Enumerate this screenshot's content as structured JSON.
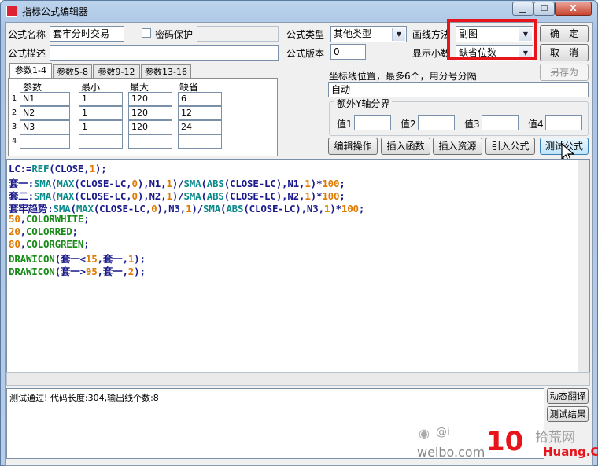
{
  "window": {
    "title": "指标公式编辑器",
    "min_label": "▁",
    "max_label": "☐",
    "close_label": "X"
  },
  "form": {
    "name_label": "公式名称",
    "name_value": "套牢分时交易",
    "password_label": "密码保护",
    "desc_label": "公式描述",
    "desc_value": "",
    "type_label": "公式类型",
    "type_value": "其他类型",
    "version_label": "公式版本",
    "version_value": "0",
    "draw_label": "画线方法",
    "draw_value": "副图",
    "decimal_label": "显示小数",
    "decimal_value": "缺省位数"
  },
  "buttons": {
    "ok": "确　定",
    "cancel": "取　消",
    "save_as": "另存为",
    "edit_ops": "编辑操作",
    "insert_func": "插入函数",
    "insert_res": "插入资源",
    "import_formula": "引入公式",
    "test_formula": "测试公式",
    "dynamic_translate": "动态翻译",
    "test_result": "测试结果"
  },
  "tabs": [
    "参数1-4",
    "参数5-8",
    "参数9-12",
    "参数13-16"
  ],
  "params": {
    "headers": [
      "参数",
      "最小",
      "最大",
      "缺省"
    ],
    "rows": [
      {
        "num": "1",
        "name": "N1",
        "min": "1",
        "max": "120",
        "def": "6"
      },
      {
        "num": "2",
        "name": "N2",
        "min": "1",
        "max": "120",
        "def": "12"
      },
      {
        "num": "3",
        "name": "N3",
        "min": "1",
        "max": "120",
        "def": "24"
      },
      {
        "num": "4",
        "name": "",
        "min": "",
        "max": "",
        "def": ""
      }
    ]
  },
  "axis": {
    "label": "坐标线位置，最多6个，用分号分隔",
    "value": "自动",
    "extra_label": "额外Y轴分界",
    "val_labels": [
      "值1",
      "值2",
      "值3",
      "值4"
    ]
  },
  "code_lines": [
    [
      [
        "w",
        "LC:="
      ],
      [
        "f",
        "REF"
      ],
      [
        "w",
        "("
      ],
      [
        "w",
        "CLOSE"
      ],
      [
        "w",
        ","
      ],
      [
        "n",
        "1"
      ],
      [
        "w",
        ");"
      ]
    ],
    [
      [
        "w",
        "套一:"
      ],
      [
        "f",
        "SMA"
      ],
      [
        "w",
        "("
      ],
      [
        "f",
        "MAX"
      ],
      [
        "w",
        "("
      ],
      [
        "w",
        "CLOSE-LC"
      ],
      [
        "w",
        ","
      ],
      [
        "n",
        "0"
      ],
      [
        "w",
        "),N1,"
      ],
      [
        "n",
        "1"
      ],
      [
        "w",
        ")/"
      ],
      [
        "f",
        "SMA"
      ],
      [
        "w",
        "("
      ],
      [
        "f",
        "ABS"
      ],
      [
        "w",
        "("
      ],
      [
        "w",
        "CLOSE-LC"
      ],
      [
        "w",
        "),N1,"
      ],
      [
        "n",
        "1"
      ],
      [
        "w",
        ")*"
      ],
      [
        "n",
        "100"
      ],
      [
        "w",
        ";"
      ]
    ],
    [
      [
        "w",
        "套二:"
      ],
      [
        "f",
        "SMA"
      ],
      [
        "w",
        "("
      ],
      [
        "f",
        "MAX"
      ],
      [
        "w",
        "("
      ],
      [
        "w",
        "CLOSE-LC"
      ],
      [
        "w",
        ","
      ],
      [
        "n",
        "0"
      ],
      [
        "w",
        "),N2,"
      ],
      [
        "n",
        "1"
      ],
      [
        "w",
        ")/"
      ],
      [
        "f",
        "SMA"
      ],
      [
        "w",
        "("
      ],
      [
        "f",
        "ABS"
      ],
      [
        "w",
        "("
      ],
      [
        "w",
        "CLOSE-LC"
      ],
      [
        "w",
        "),N2,"
      ],
      [
        "n",
        "1"
      ],
      [
        "w",
        ")*"
      ],
      [
        "n",
        "100"
      ],
      [
        "w",
        ";"
      ]
    ],
    [
      [
        "w",
        "套牢趋势:"
      ],
      [
        "f",
        "SMA"
      ],
      [
        "w",
        "("
      ],
      [
        "f",
        "MAX"
      ],
      [
        "w",
        "("
      ],
      [
        "w",
        "CLOSE-LC"
      ],
      [
        "w",
        ","
      ],
      [
        "n",
        "0"
      ],
      [
        "w",
        "),N3,"
      ],
      [
        "n",
        "1"
      ],
      [
        "w",
        ")/"
      ],
      [
        "f",
        "SMA"
      ],
      [
        "w",
        "("
      ],
      [
        "f",
        "ABS"
      ],
      [
        "w",
        "("
      ],
      [
        "w",
        "CLOSE-LC"
      ],
      [
        "w",
        "),N3,"
      ],
      [
        "n",
        "1"
      ],
      [
        "w",
        ")*"
      ],
      [
        "n",
        "100"
      ],
      [
        "w",
        ";"
      ]
    ],
    [
      [
        "n",
        "50"
      ],
      [
        "w",
        ","
      ],
      [
        "k",
        "COLORWHITE"
      ],
      [
        "w",
        ";"
      ]
    ],
    [
      [
        "n",
        "20"
      ],
      [
        "w",
        ","
      ],
      [
        "k",
        "COLORRED"
      ],
      [
        "w",
        ";"
      ]
    ],
    [
      [
        "n",
        "80"
      ],
      [
        "w",
        ","
      ],
      [
        "k",
        "COLORGREEN"
      ],
      [
        "w",
        ";"
      ]
    ],
    [
      [
        "k",
        "DRAWICON"
      ],
      [
        "w",
        "(套一<"
      ],
      [
        "n",
        "15"
      ],
      [
        "w",
        ",套一,"
      ],
      [
        "n",
        "1"
      ],
      [
        "w",
        ");"
      ]
    ],
    [
      [
        "k",
        "DRAWICON"
      ],
      [
        "w",
        "(套一>"
      ],
      [
        "n",
        "95"
      ],
      [
        "w",
        ",套一,"
      ],
      [
        "n",
        "2"
      ],
      [
        "w",
        ");"
      ]
    ]
  ],
  "status_text": "测试通过! 代码长度:304,输出线个数:8",
  "watermark": {
    "line1": "@i",
    "line2": "weibo.com",
    "big": "10",
    "site": "拾荒网",
    "domain": "Huang.CN"
  },
  "colors": {
    "highlight": "#e8141b",
    "word": "#1a1a8c",
    "function": "#0a8a8a",
    "number": "#e07a00",
    "color_keyword": "#158a15"
  }
}
